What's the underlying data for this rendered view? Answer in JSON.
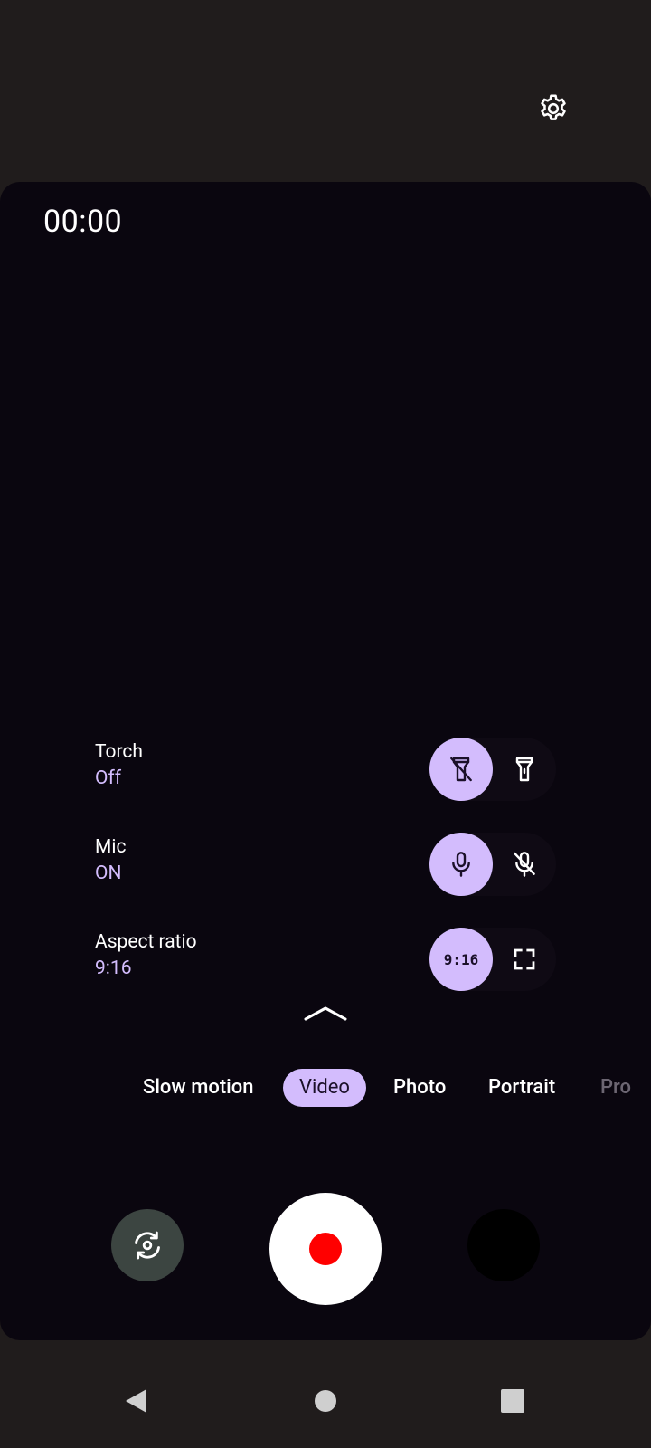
{
  "header": {
    "settings_icon": "gear-icon"
  },
  "viewfinder": {
    "timer": "00:00"
  },
  "toggles": {
    "torch": {
      "label": "Torch",
      "value": "Off",
      "options": [
        "flashlight-off-icon",
        "flashlight-on-icon"
      ],
      "selected_index": 0
    },
    "mic": {
      "label": "Mic",
      "value": "ON",
      "options": [
        "mic-icon",
        "mic-off-icon"
      ],
      "selected_index": 0
    },
    "aspect_ratio": {
      "label": "Aspect ratio",
      "value": "9:16",
      "option_left_text": "9:16",
      "options": [
        "ratio-9-16",
        "fullscreen-icon"
      ],
      "selected_index": 0
    }
  },
  "expand_icon": "chevron-up-icon",
  "modes": {
    "items": [
      {
        "label": "Slow motion"
      },
      {
        "label": "Video"
      },
      {
        "label": "Photo"
      },
      {
        "label": "Portrait"
      },
      {
        "label": "Pro"
      }
    ],
    "selected": "Video"
  },
  "controls": {
    "flip_icon": "flip-camera-icon",
    "record_icon": "record-icon",
    "thumbnail": "gallery-thumbnail"
  },
  "navbar": {
    "back_icon": "back-triangle-icon",
    "home_icon": "home-circle-icon",
    "recents_icon": "recents-square-icon"
  },
  "colors": {
    "accent": "#d3bcfd",
    "record": "#ff0000",
    "background": "#201c1c",
    "viewfinder": "#0a060f"
  }
}
